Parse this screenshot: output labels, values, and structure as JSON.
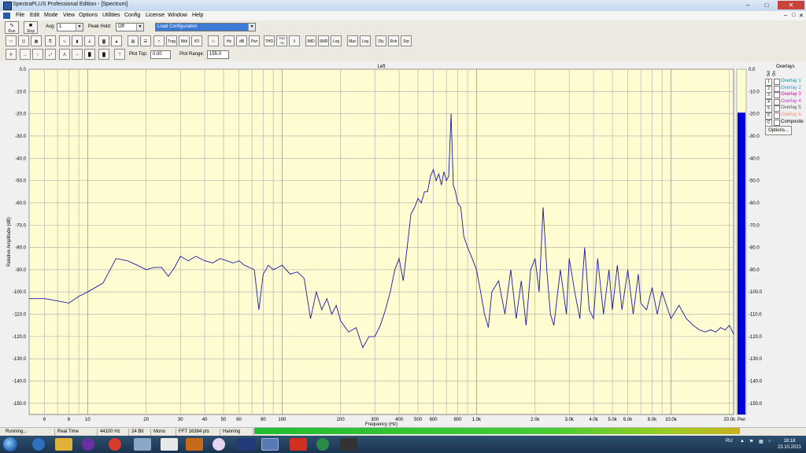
{
  "window": {
    "title": "SpectraPLUS Professional Edition - [Spectrum]"
  },
  "menu": [
    "File",
    "Edit",
    "Mode",
    "View",
    "Options",
    "Utilities",
    "Config",
    "License",
    "Window",
    "Help"
  ],
  "toolbar1": {
    "run_label": "Run",
    "stop_label": "Stop",
    "avg_label": "Avg:",
    "avg_value": "1",
    "peakhold_label": "Peak Hold:",
    "peakhold_value": "Off",
    "config_value": "Load Configuration"
  },
  "toolbar2": [
    "Trag",
    "Mrk",
    "I/O",
    "Hz",
    "dB",
    "Pwr",
    "THD",
    "THD +N",
    "IMD",
    "SNR",
    "Log",
    "Mac",
    "Log",
    "Dly",
    "Rvb",
    "Srp"
  ],
  "toolbar3": {
    "plot_top_label": "Plot Top:",
    "plot_top_value": "0.00",
    "plot_range_label": "Plot Range:",
    "plot_range_value": "155.0"
  },
  "overlays": {
    "header": "Overlays",
    "sel_label": "Sel",
    "on_label": "On",
    "items": [
      {
        "num": "1",
        "name": "Overlay 1",
        "color": "#009999"
      },
      {
        "num": "2",
        "name": "Overlay 2",
        "color": "#3399cc"
      },
      {
        "num": "3",
        "name": "Overlay 3",
        "color": "#cc0099"
      },
      {
        "num": "4",
        "name": "Overlay 4",
        "color": "#cc33cc"
      },
      {
        "num": "5",
        "name": "Overlay 5",
        "color": "#555555"
      },
      {
        "num": "6",
        "name": "Overlay 6",
        "color": "#ff8866"
      },
      {
        "num": "C",
        "name": "Composite",
        "color": "#000000"
      }
    ],
    "options_label": "Options..."
  },
  "chart_data": {
    "type": "line",
    "title": "Left",
    "xlabel": "Frequency (Hz)",
    "ylabel": "Relative Amplitude (dB)",
    "xscale": "log",
    "xlim": [
      5,
      21000
    ],
    "ylim": [
      -155,
      0
    ],
    "grid": true,
    "line_color": "#1a1aa8",
    "xticks": [
      "6",
      "8",
      "10",
      "20",
      "30",
      "40",
      "50",
      "60",
      "80",
      "100",
      "200",
      "300",
      "400",
      "500",
      "600",
      "800",
      "1.0k",
      "2.0k",
      "3.0k",
      "4.0k",
      "5.0k",
      "6.0k",
      "8.0k",
      "10.0k",
      "20.0k"
    ],
    "xtick_values": [
      6,
      8,
      10,
      20,
      30,
      40,
      50,
      60,
      80,
      100,
      200,
      300,
      400,
      500,
      600,
      800,
      1000,
      2000,
      3000,
      4000,
      5000,
      6000,
      8000,
      10000,
      20000
    ],
    "yticks": [
      "0.0",
      "-10.0",
      "-20.0",
      "-30.0",
      "-40.0",
      "-50.0",
      "-60.0",
      "-70.0",
      "-80.0",
      "-90.0",
      "-100.0",
      "-110.0",
      "-120.0",
      "-130.0",
      "-140.0",
      "-150.0"
    ],
    "ytick_values": [
      0,
      -10,
      -20,
      -30,
      -40,
      -50,
      -60,
      -70,
      -80,
      -90,
      -100,
      -110,
      -120,
      -130,
      -140,
      -150
    ],
    "series": [
      {
        "x": [
          5,
          6,
          7,
          8,
          9,
          10,
          12,
          14,
          16,
          18,
          20,
          22,
          24,
          26,
          28,
          30,
          33,
          36,
          40,
          44,
          48,
          52,
          56,
          60,
          64,
          68,
          72,
          76,
          80,
          85,
          90,
          95,
          100,
          110,
          120,
          130,
          140,
          150,
          160,
          170,
          180,
          190,
          200,
          220,
          240,
          260,
          280,
          300,
          320,
          340,
          360,
          380,
          400,
          420,
          440,
          460,
          480,
          500,
          520,
          540,
          560,
          580,
          600,
          620,
          640,
          660,
          680,
          700,
          720,
          740,
          760,
          780,
          800,
          830,
          860,
          900,
          950,
          1000,
          1050,
          1100,
          1150,
          1200,
          1300,
          1400,
          1500,
          1600,
          1700,
          1800,
          1900,
          2000,
          2100,
          2200,
          2300,
          2400,
          2500,
          2700,
          2900,
          3000,
          3200,
          3400,
          3600,
          3800,
          4000,
          4200,
          4500,
          4800,
          5000,
          5300,
          5600,
          6000,
          6400,
          6800,
          7000,
          7500,
          8000,
          8500,
          9000,
          10000,
          11000,
          12000,
          13000,
          14000,
          15000,
          16000,
          17000,
          18000,
          19000,
          20000,
          21000
        ],
        "y": [
          -103,
          -103,
          -104,
          -105,
          -102,
          -100,
          -96,
          -85,
          -86,
          -88,
          -90,
          -89,
          -89,
          -93,
          -89,
          -84,
          -86,
          -84,
          -86,
          -87,
          -85,
          -86,
          -87,
          -86,
          -88,
          -89,
          -90,
          -108,
          -92,
          -88,
          -90,
          -89,
          -88,
          -92,
          -91,
          -94,
          -112,
          -100,
          -108,
          -103,
          -110,
          -106,
          -113,
          -118,
          -116,
          -125,
          -120,
          -120,
          -115,
          -108,
          -100,
          -90,
          -85,
          -95,
          -80,
          -65,
          -62,
          -58,
          -60,
          -55,
          -55,
          -48,
          -45,
          -50,
          -47,
          -52,
          -46,
          -50,
          -48,
          -20,
          -52,
          -55,
          -60,
          -62,
          -75,
          -80,
          -85,
          -90,
          -100,
          -110,
          -116,
          -100,
          -95,
          -110,
          -90,
          -112,
          -95,
          -115,
          -90,
          -85,
          -100,
          -62,
          -90,
          -110,
          -115,
          -90,
          -110,
          -85,
          -100,
          -112,
          -80,
          -108,
          -112,
          -85,
          -110,
          -90,
          -108,
          -88,
          -108,
          -90,
          -110,
          -92,
          -105,
          -108,
          -98,
          -110,
          -100,
          -112,
          -106,
          -112,
          -115,
          -117,
          -118,
          -117,
          -118,
          -116,
          -117,
          -115,
          -119
        ]
      }
    ]
  },
  "level_meter": {
    "label": "Pwr",
    "level_db": -19.5
  },
  "statusbar": {
    "status": "Running...",
    "mode": "Real Time",
    "rate": "44100 Hz",
    "bits": "24 Bit",
    "channels": "Mono",
    "fft": "FFT 16384 pts",
    "window": "Hanning"
  },
  "taskbar": {
    "lang": "RU",
    "time": "18:18",
    "date": "23.10.2021"
  }
}
